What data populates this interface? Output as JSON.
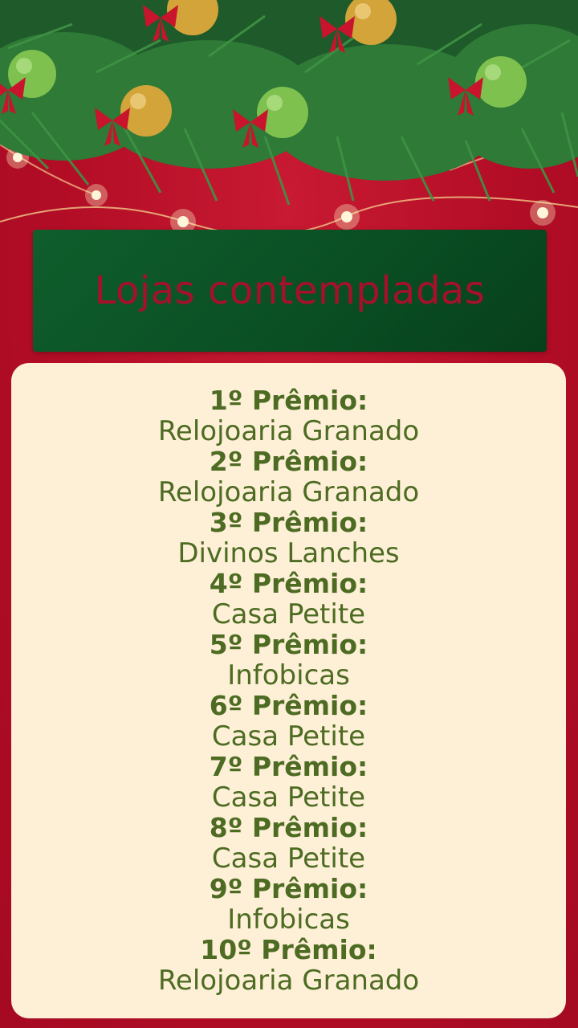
{
  "title": "Lojas contempladas",
  "colors": {
    "background_red": "#b8102a",
    "title_box_green": "#0a4f24",
    "title_text_red": "#a6102a",
    "panel_cream": "#fdf0d6",
    "prize_text_green": "#4d6b22"
  },
  "decoration": {
    "garland": "pine-garland-with-ornaments-icon",
    "lights": "string-lights-icon"
  },
  "prizes": [
    {
      "label": "1º Prêmio:",
      "store": "Relojoaria Granado"
    },
    {
      "label": "2º Prêmio:",
      "store": "Relojoaria Granado"
    },
    {
      "label": "3º Prêmio:",
      "store": "Divinos Lanches"
    },
    {
      "label": "4º Prêmio:",
      "store": "Casa Petite"
    },
    {
      "label": "5º Prêmio:",
      "store": "Infobicas"
    },
    {
      "label": "6º Prêmio:",
      "store": "Casa Petite"
    },
    {
      "label": "7º Prêmio:",
      "store": "Casa Petite"
    },
    {
      "label": "8º Prêmio:",
      "store": "Casa Petite"
    },
    {
      "label": "9º Prêmio:",
      "store": "Infobicas"
    },
    {
      "label": "10º Prêmio:",
      "store": "Relojoaria Granado"
    }
  ]
}
